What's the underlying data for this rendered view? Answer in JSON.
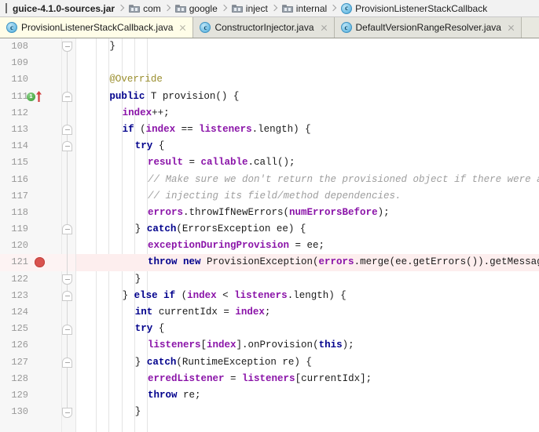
{
  "breadcrumb": {
    "items": [
      {
        "label": "guice-4.1.0-sources.jar",
        "icon": "jar-icon",
        "kind": "jar"
      },
      {
        "label": "com",
        "icon": "folder-icon",
        "kind": "folder"
      },
      {
        "label": "google",
        "icon": "folder-icon",
        "kind": "folder"
      },
      {
        "label": "inject",
        "icon": "folder-icon",
        "kind": "folder"
      },
      {
        "label": "internal",
        "icon": "folder-icon",
        "kind": "folder"
      },
      {
        "label": "ProvisionListenerStackCallback",
        "icon": "java-class-icon",
        "kind": "class"
      }
    ]
  },
  "tabs": [
    {
      "label": "ProvisionListenerStackCallback.java",
      "icon": "java-class-icon",
      "active": true,
      "close_icon": "close-icon"
    },
    {
      "label": "ConstructorInjector.java",
      "icon": "java-class-icon",
      "active": false,
      "close_icon": "close-icon"
    },
    {
      "label": "DefaultVersionRangeResolver.java",
      "icon": "java-class-icon",
      "active": false,
      "close_icon": "close-icon"
    }
  ],
  "editor": {
    "first_line": 108,
    "last_line": 130,
    "breakpoint_line": 121,
    "implementing_marker_line": 111,
    "implementing_marker_badge": "1",
    "colors": {
      "keyword": "#00008c",
      "field": "#8a13a8",
      "comment": "#9e9e9e",
      "annotation": "#9b8f2f",
      "breakpoint": "#d9534f",
      "highlight_line_bg": "#fdeeee",
      "active_tab_bg": "#fffde8"
    },
    "lines": [
      {
        "n": 108,
        "indent": 2,
        "tokens": [
          {
            "t": "}",
            "c": "txt"
          }
        ]
      },
      {
        "n": 109,
        "indent": 0,
        "tokens": []
      },
      {
        "n": 110,
        "indent": 2,
        "tokens": [
          {
            "t": "@Override",
            "c": "ann"
          }
        ]
      },
      {
        "n": 111,
        "indent": 2,
        "tokens": [
          {
            "t": "public ",
            "c": "kw"
          },
          {
            "t": "T ",
            "c": "typ"
          },
          {
            "t": "provision() {",
            "c": "txt"
          }
        ]
      },
      {
        "n": 112,
        "indent": 3,
        "tokens": [
          {
            "t": "index",
            "c": "fld"
          },
          {
            "t": "++;",
            "c": "txt"
          }
        ]
      },
      {
        "n": 113,
        "indent": 3,
        "tokens": [
          {
            "t": "if ",
            "c": "kw"
          },
          {
            "t": "(",
            "c": "txt"
          },
          {
            "t": "index",
            "c": "fld"
          },
          {
            "t": " == ",
            "c": "txt"
          },
          {
            "t": "listeners",
            "c": "fld"
          },
          {
            "t": ".length) {",
            "c": "txt"
          }
        ]
      },
      {
        "n": 114,
        "indent": 4,
        "tokens": [
          {
            "t": "try ",
            "c": "kw"
          },
          {
            "t": "{",
            "c": "txt"
          }
        ]
      },
      {
        "n": 115,
        "indent": 5,
        "tokens": [
          {
            "t": "result",
            "c": "fld"
          },
          {
            "t": " = ",
            "c": "txt"
          },
          {
            "t": "callable",
            "c": "fld"
          },
          {
            "t": ".call();",
            "c": "txt"
          }
        ]
      },
      {
        "n": 116,
        "indent": 5,
        "tokens": [
          {
            "t": "// Make sure we don't return the provisioned object if there were any errors",
            "c": "cmt"
          }
        ]
      },
      {
        "n": 117,
        "indent": 5,
        "tokens": [
          {
            "t": "// injecting its field/method dependencies.",
            "c": "cmt"
          }
        ]
      },
      {
        "n": 118,
        "indent": 5,
        "tokens": [
          {
            "t": "errors",
            "c": "fld"
          },
          {
            "t": ".throwIfNewErrors(",
            "c": "txt"
          },
          {
            "t": "numErrorsBefore",
            "c": "fld"
          },
          {
            "t": ");",
            "c": "txt"
          }
        ]
      },
      {
        "n": 119,
        "indent": 4,
        "tokens": [
          {
            "t": "} ",
            "c": "txt"
          },
          {
            "t": "catch",
            "c": "kw"
          },
          {
            "t": "(ErrorsException ee) {",
            "c": "txt"
          }
        ]
      },
      {
        "n": 120,
        "indent": 5,
        "tokens": [
          {
            "t": "exceptionDuringProvision",
            "c": "fld"
          },
          {
            "t": " = ee;",
            "c": "txt"
          }
        ]
      },
      {
        "n": 121,
        "indent": 5,
        "tokens": [
          {
            "t": "throw new ",
            "c": "kw"
          },
          {
            "t": "ProvisionException(",
            "c": "txt"
          },
          {
            "t": "errors",
            "c": "fld"
          },
          {
            "t": ".merge(ee.getErrors()).getMessages());",
            "c": "txt"
          }
        ]
      },
      {
        "n": 122,
        "indent": 4,
        "tokens": [
          {
            "t": "}",
            "c": "txt"
          }
        ]
      },
      {
        "n": 123,
        "indent": 3,
        "tokens": [
          {
            "t": "} ",
            "c": "txt"
          },
          {
            "t": "else if ",
            "c": "kw"
          },
          {
            "t": "(",
            "c": "txt"
          },
          {
            "t": "index",
            "c": "fld"
          },
          {
            "t": " < ",
            "c": "txt"
          },
          {
            "t": "listeners",
            "c": "fld"
          },
          {
            "t": ".length) {",
            "c": "txt"
          }
        ]
      },
      {
        "n": 124,
        "indent": 4,
        "tokens": [
          {
            "t": "int ",
            "c": "kw"
          },
          {
            "t": "currentIdx = ",
            "c": "txt"
          },
          {
            "t": "index",
            "c": "fld"
          },
          {
            "t": ";",
            "c": "txt"
          }
        ]
      },
      {
        "n": 125,
        "indent": 4,
        "tokens": [
          {
            "t": "try ",
            "c": "kw"
          },
          {
            "t": "{",
            "c": "txt"
          }
        ]
      },
      {
        "n": 126,
        "indent": 5,
        "tokens": [
          {
            "t": "listeners",
            "c": "fld"
          },
          {
            "t": "[",
            "c": "txt"
          },
          {
            "t": "index",
            "c": "fld"
          },
          {
            "t": "].onProvision(",
            "c": "txt"
          },
          {
            "t": "this",
            "c": "kw"
          },
          {
            "t": ");",
            "c": "txt"
          }
        ]
      },
      {
        "n": 127,
        "indent": 4,
        "tokens": [
          {
            "t": "} ",
            "c": "txt"
          },
          {
            "t": "catch",
            "c": "kw"
          },
          {
            "t": "(RuntimeException re) {",
            "c": "txt"
          }
        ]
      },
      {
        "n": 128,
        "indent": 5,
        "tokens": [
          {
            "t": "erredListener",
            "c": "fld"
          },
          {
            "t": " = ",
            "c": "txt"
          },
          {
            "t": "listeners",
            "c": "fld"
          },
          {
            "t": "[currentIdx];",
            "c": "txt"
          }
        ]
      },
      {
        "n": 129,
        "indent": 5,
        "tokens": [
          {
            "t": "throw ",
            "c": "kw"
          },
          {
            "t": "re;",
            "c": "txt"
          }
        ]
      },
      {
        "n": 130,
        "indent": 4,
        "tokens": [
          {
            "t": "}",
            "c": "txt"
          }
        ]
      }
    ],
    "fold_markers": [
      {
        "line": 108,
        "type": "end"
      },
      {
        "line": 111,
        "type": "start"
      },
      {
        "line": 113,
        "type": "start"
      },
      {
        "line": 114,
        "type": "start"
      },
      {
        "line": 119,
        "type": "start"
      },
      {
        "line": 122,
        "type": "end"
      },
      {
        "line": 123,
        "type": "start"
      },
      {
        "line": 125,
        "type": "start"
      },
      {
        "line": 127,
        "type": "start"
      },
      {
        "line": 130,
        "type": "end"
      }
    ]
  }
}
